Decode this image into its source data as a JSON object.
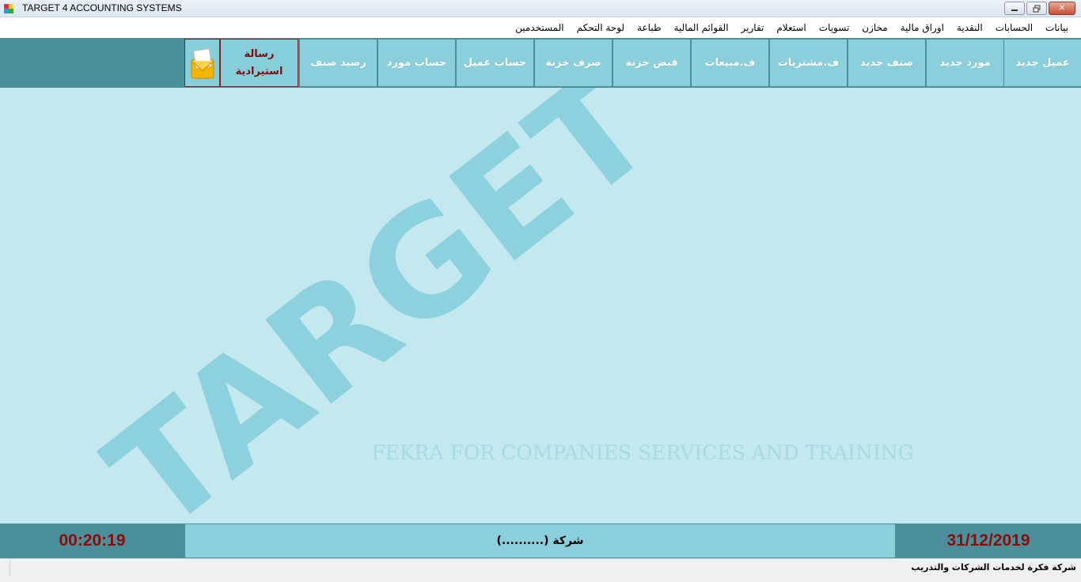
{
  "window": {
    "title": "TARGET 4 ACCOUNTING SYSTEMS",
    "minimize_icon": "minimize-icon",
    "restore_icon": "restore-icon",
    "close_icon": "close-icon"
  },
  "menu": {
    "items": [
      "بيانات",
      "الحسابات",
      "النقدية",
      "اوراق مالية",
      "مخازن",
      "تسويات",
      "استعلام",
      "تقارير",
      "القوائم المالية",
      "طباعة",
      "لوحة التحكم",
      "المستخدمين"
    ]
  },
  "toolbar": {
    "buttons": [
      "عميل جديد",
      "مورد جديد",
      "صنف جديد",
      "ف.مشتريات",
      "ف.مبيعات",
      "قبض خزنة",
      "صرف خزنة",
      "حساب عميل",
      "حساب مورد",
      "رصيد صنف"
    ],
    "message_line1": "رسالة",
    "message_line2": "استيرادية",
    "mail_icon": "envelope-icon"
  },
  "watermark": {
    "logo": "TARGET",
    "subtitle": "FEKRA FOR COMPANIES SERVICES AND TRAINING"
  },
  "status": {
    "time": "00:20:19",
    "company": "(..........) شركة",
    "date": "31/12/2019"
  },
  "footer": {
    "text": "شركة فكرة لخدمات الشركات والتدريب"
  },
  "colors": {
    "toolbar_bg": "#4a8f9a",
    "button_bg": "#8ccfdc",
    "main_bg": "#c3e8ee",
    "accent_red": "#8b0c0c"
  }
}
